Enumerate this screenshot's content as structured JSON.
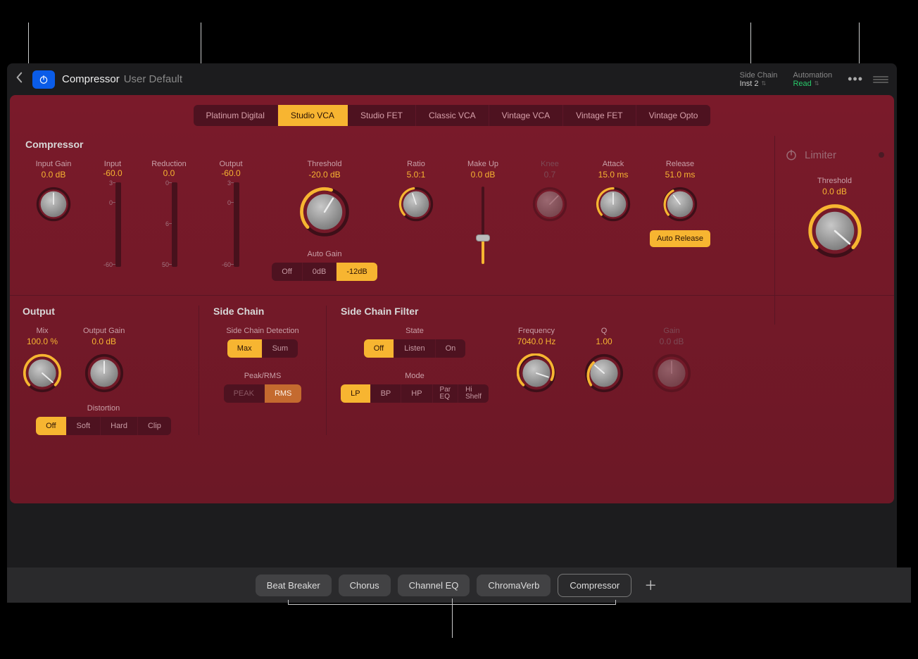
{
  "header": {
    "plugin_name": "Compressor",
    "preset": "User Default",
    "sidechain_label": "Side Chain",
    "sidechain_value": "Inst 2",
    "automation_label": "Automation",
    "automation_value": "Read"
  },
  "model_tabs": [
    "Platinum Digital",
    "Studio VCA",
    "Studio FET",
    "Classic VCA",
    "Vintage VCA",
    "Vintage FET",
    "Vintage Opto"
  ],
  "model_active": "Studio VCA",
  "main_title": "Compressor",
  "params": {
    "input_gain": {
      "label": "Input Gain",
      "value": "0.0 dB"
    },
    "input": {
      "label": "Input",
      "value": "-60.0",
      "ticks": [
        "3",
        "0",
        "-60"
      ]
    },
    "reduction": {
      "label": "Reduction",
      "value": "0.0",
      "ticks": [
        "0",
        "6",
        "50"
      ]
    },
    "output": {
      "label": "Output",
      "value": "-60.0",
      "ticks": [
        "3",
        "0",
        "-60"
      ]
    },
    "threshold": {
      "label": "Threshold",
      "value": "-20.0 dB"
    },
    "ratio": {
      "label": "Ratio",
      "value": "5.0:1"
    },
    "makeup": {
      "label": "Make Up",
      "value": "0.0 dB"
    },
    "knee": {
      "label": "Knee",
      "value": "0.7"
    },
    "attack": {
      "label": "Attack",
      "value": "15.0 ms"
    },
    "release": {
      "label": "Release",
      "value": "51.0 ms"
    },
    "autogain_label": "Auto Gain",
    "autogain_opts": [
      "Off",
      "0dB",
      "-12dB"
    ],
    "autogain_active": "-12dB",
    "autorelease": "Auto Release"
  },
  "limiter": {
    "title": "Limiter",
    "threshold_label": "Threshold",
    "threshold_value": "0.0 dB"
  },
  "output_sec": {
    "title": "Output",
    "mix": {
      "label": "Mix",
      "value": "100.0 %"
    },
    "outgain": {
      "label": "Output Gain",
      "value": "0.0 dB"
    },
    "distortion_label": "Distortion",
    "distortion_opts": [
      "Off",
      "Soft",
      "Hard",
      "Clip"
    ],
    "distortion_active": "Off"
  },
  "sidechain_sec": {
    "title": "Side Chain",
    "detection_label": "Side Chain Detection",
    "detection_opts": [
      "Max",
      "Sum"
    ],
    "detection_active": "Max",
    "peakrms_label": "Peak/RMS",
    "peakrms_opts": [
      "PEAK",
      "RMS"
    ],
    "peakrms_active": "RMS"
  },
  "scfilter_sec": {
    "title": "Side Chain Filter",
    "state_label": "State",
    "state_opts": [
      "Off",
      "Listen",
      "On"
    ],
    "state_active": "Off",
    "mode_label": "Mode",
    "mode_opts": [
      "LP",
      "BP",
      "HP",
      "Par EQ",
      "Hi Shelf"
    ],
    "mode_active": "LP",
    "freq": {
      "label": "Frequency",
      "value": "7040.0 Hz"
    },
    "q": {
      "label": "Q",
      "value": "1.00"
    },
    "gain": {
      "label": "Gain",
      "value": "0.0 dB"
    }
  },
  "bottom_pills": [
    "Beat Breaker",
    "Chorus",
    "Channel EQ",
    "ChromaVerb",
    "Compressor"
  ],
  "bottom_active": "Compressor"
}
